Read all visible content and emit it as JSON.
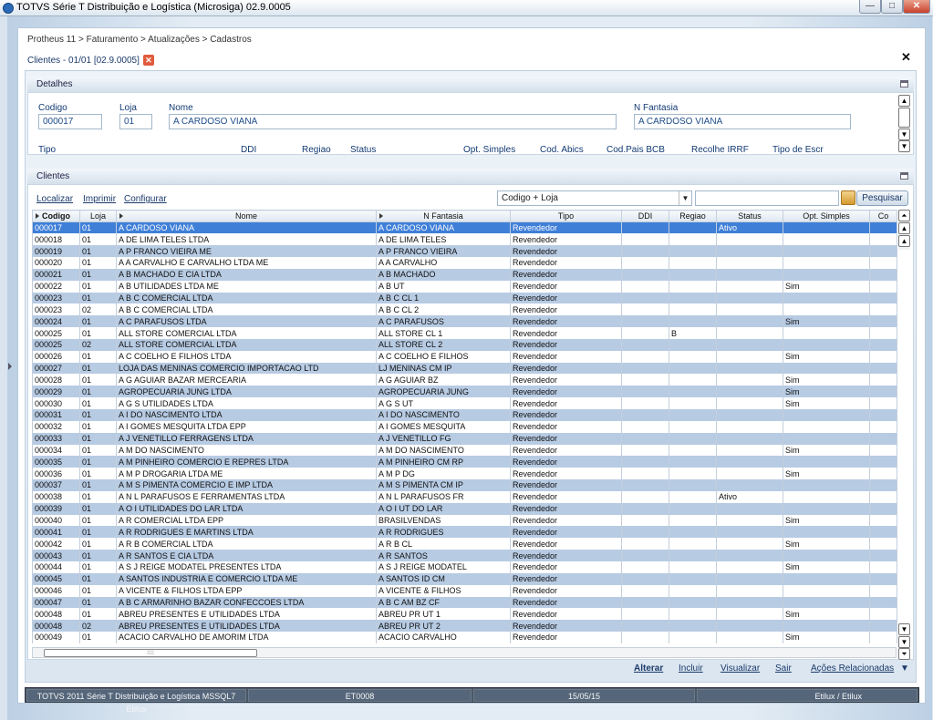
{
  "window": {
    "title": "TOTVS Série T Distribuição e Logística (Microsiga) 02.9.0005",
    "buttons": [
      "—",
      "□",
      "✕"
    ]
  },
  "breadcrumb": "Protheus 11 > Faturamento > Atualizações > Cadastros",
  "tab": {
    "label": "Clientes - 01/01 [02.9.0005]",
    "close": "✕"
  },
  "close_all": "✕",
  "details": {
    "header": "Detalhes",
    "fields": {
      "codigo": {
        "label": "Codigo",
        "value": "000017"
      },
      "loja": {
        "label": "Loja",
        "value": "01"
      },
      "nome": {
        "label": "Nome",
        "value": "A CARDOSO VIANA"
      },
      "fantasia": {
        "label": "N Fantasia",
        "value": "A CARDOSO VIANA"
      }
    },
    "row2_labels": [
      "Tipo",
      "DDI",
      "Regiao",
      "Status",
      "Opt. Simples",
      "Cod. Abics",
      "Cod.Pais BCB",
      "Recolhe IRRF",
      "Tipo de Escr"
    ]
  },
  "clientes": {
    "header": "Clientes",
    "links": {
      "localizar": "Localizar",
      "imprimir": "Imprimir",
      "configurar": "Configurar"
    },
    "order": "Codigo + Loja",
    "search_button": "Pesquisar",
    "columns": [
      "Codigo",
      "Loja",
      "Nome",
      "N Fantasia",
      "Tipo",
      "DDI",
      "Regiao",
      "Status",
      "Opt. Simples",
      "Co"
    ],
    "rows": [
      [
        "000017",
        "01",
        "A CARDOSO VIANA",
        "A CARDOSO VIANA",
        "Revendedor",
        "",
        "",
        "Ativo",
        "",
        ""
      ],
      [
        "000018",
        "01",
        "A DE LIMA TELES LTDA",
        "A DE LIMA TELES",
        "Revendedor",
        "",
        "",
        "",
        "",
        ""
      ],
      [
        "000019",
        "01",
        "A P FRANCO VIEIRA ME",
        "A P FRANCO VIEIRA",
        "Revendedor",
        "",
        "",
        "",
        "",
        ""
      ],
      [
        "000020",
        "01",
        "A A CARVALHO E CARVALHO LTDA ME",
        "A A CARVALHO",
        "Revendedor",
        "",
        "",
        "",
        "",
        ""
      ],
      [
        "000021",
        "01",
        "A B MACHADO E CIA LTDA",
        "A B MACHADO",
        "Revendedor",
        "",
        "",
        "",
        "",
        ""
      ],
      [
        "000022",
        "01",
        "A B UTILIDADES LTDA ME",
        "A B UT",
        "Revendedor",
        "",
        "",
        "",
        "Sim",
        ""
      ],
      [
        "000023",
        "01",
        "A B C COMERCIAL LTDA",
        "A B C CL 1",
        "Revendedor",
        "",
        "",
        "",
        "",
        ""
      ],
      [
        "000023",
        "02",
        "A B C COMERCIAL LTDA",
        "A B C CL 2",
        "Revendedor",
        "",
        "",
        "",
        "",
        ""
      ],
      [
        "000024",
        "01",
        "A C PARAFUSOS LTDA",
        "A C PARAFUSOS",
        "Revendedor",
        "",
        "",
        "",
        "Sim",
        ""
      ],
      [
        "000025",
        "01",
        "ALL STORE COMERCIAL LTDA",
        "ALL STORE CL 1",
        "Revendedor",
        "",
        "B",
        "",
        "",
        ""
      ],
      [
        "000025",
        "02",
        "ALL STORE COMERCIAL LTDA",
        "ALL STORE CL 2",
        "Revendedor",
        "",
        "",
        "",
        "",
        ""
      ],
      [
        "000026",
        "01",
        "A C COELHO E FILHOS LTDA",
        "A C COELHO E FILHOS",
        "Revendedor",
        "",
        "",
        "",
        "Sim",
        ""
      ],
      [
        "000027",
        "01",
        "LOJA DAS MENINAS COMERCIO IMPORTACAO LTD",
        "LJ MENINAS CM IP",
        "Revendedor",
        "",
        "",
        "",
        "",
        ""
      ],
      [
        "000028",
        "01",
        "A G AGUIAR BAZAR MERCEARIA",
        "A G AGUIAR BZ",
        "Revendedor",
        "",
        "",
        "",
        "Sim",
        ""
      ],
      [
        "000029",
        "01",
        "AGROPECUARIA JUNG LTDA",
        "AGROPECUARIA JUNG",
        "Revendedor",
        "",
        "",
        "",
        "Sim",
        ""
      ],
      [
        "000030",
        "01",
        "A G S UTILIDADES LTDA",
        "A G S UT",
        "Revendedor",
        "",
        "",
        "",
        "Sim",
        ""
      ],
      [
        "000031",
        "01",
        "A I DO NASCIMENTO LTDA",
        "A I DO NASCIMENTO",
        "Revendedor",
        "",
        "",
        "",
        "",
        ""
      ],
      [
        "000032",
        "01",
        "A I GOMES MESQUITA LTDA EPP",
        "A I GOMES MESQUITA",
        "Revendedor",
        "",
        "",
        "",
        "",
        ""
      ],
      [
        "000033",
        "01",
        "A J VENETILLO FERRAGENS LTDA",
        "A J VENETILLO FG",
        "Revendedor",
        "",
        "",
        "",
        "",
        ""
      ],
      [
        "000034",
        "01",
        "A M DO NASCIMENTO",
        "A M DO NASCIMENTO",
        "Revendedor",
        "",
        "",
        "",
        "Sim",
        ""
      ],
      [
        "000035",
        "01",
        "A M PINHEIRO COMERCIO E REPRES LTDA",
        "A M PINHEIRO CM RP",
        "Revendedor",
        "",
        "",
        "",
        "",
        ""
      ],
      [
        "000036",
        "01",
        "A M P DROGARIA LTDA ME",
        "A M P DG",
        "Revendedor",
        "",
        "",
        "",
        "Sim",
        ""
      ],
      [
        "000037",
        "01",
        "A M S PIMENTA COMERCIO E IMP LTDA",
        "A M S PIMENTA CM IP",
        "Revendedor",
        "",
        "",
        "",
        "",
        ""
      ],
      [
        "000038",
        "01",
        "A N L PARAFUSOS E FERRAMENTAS LTDA",
        "A N L PARAFUSOS FR",
        "Revendedor",
        "",
        "",
        "Ativo",
        "",
        ""
      ],
      [
        "000039",
        "01",
        "A O I UTILIDADES DO LAR LTDA",
        "A O I UT DO LAR",
        "Revendedor",
        "",
        "",
        "",
        "",
        ""
      ],
      [
        "000040",
        "01",
        "A R COMERCIAL LTDA EPP",
        "BRASILVENDAS",
        "Revendedor",
        "",
        "",
        "",
        "Sim",
        ""
      ],
      [
        "000041",
        "01",
        "A R RODRIGUES E MARTINS LTDA",
        "A R RODRIGUES",
        "Revendedor",
        "",
        "",
        "",
        "",
        ""
      ],
      [
        "000042",
        "01",
        "A R B COMERCIAL LTDA",
        "A R B CL",
        "Revendedor",
        "",
        "",
        "",
        "Sim",
        ""
      ],
      [
        "000043",
        "01",
        "A R SANTOS E CIA LTDA",
        "A R SANTOS",
        "Revendedor",
        "",
        "",
        "",
        "",
        ""
      ],
      [
        "000044",
        "01",
        "A S J REIGE MODATEL PRESENTES LTDA",
        "A S J REIGE MODATEL",
        "Revendedor",
        "",
        "",
        "",
        "Sim",
        ""
      ],
      [
        "000045",
        "01",
        "A SANTOS INDUSTRIA E COMERCIO LTDA ME",
        "A SANTOS ID CM",
        "Revendedor",
        "",
        "",
        "",
        "",
        ""
      ],
      [
        "000046",
        "01",
        "A VICENTE & FILHOS LTDA EPP",
        "A VICENTE & FILHOS",
        "Revendedor",
        "",
        "",
        "",
        "",
        ""
      ],
      [
        "000047",
        "01",
        "A B C ARMARINHO BAZAR CONFECCOES LTDA",
        "A B C AM BZ CF",
        "Revendedor",
        "",
        "",
        "",
        "",
        ""
      ],
      [
        "000048",
        "01",
        "ABREU PRESENTES E UTILIDADES LTDA",
        "ABREU PR UT 1",
        "Revendedor",
        "",
        "",
        "",
        "Sim",
        ""
      ],
      [
        "000048",
        "02",
        "ABREU PRESENTES E UTILIDADES LTDA",
        "ABREU PR UT 2",
        "Revendedor",
        "",
        "",
        "",
        "",
        ""
      ],
      [
        "000049",
        "01",
        "ACACIO CARVALHO DE AMORIM LTDA",
        "ACACIO CARVALHO",
        "Revendedor",
        "",
        "",
        "",
        "Sim",
        ""
      ]
    ]
  },
  "actions": {
    "alterar": "Alterar",
    "incluir": "Incluir",
    "visualizar": "Visualizar",
    "sair": "Sair",
    "relacionadas": "Ações Relacionadas"
  },
  "status": [
    "TOTVS 2011 Série T Distribuição e Logística MSSQL7 Etilux",
    "ET0008",
    "15/05/15",
    "Etilux / Etilux"
  ]
}
